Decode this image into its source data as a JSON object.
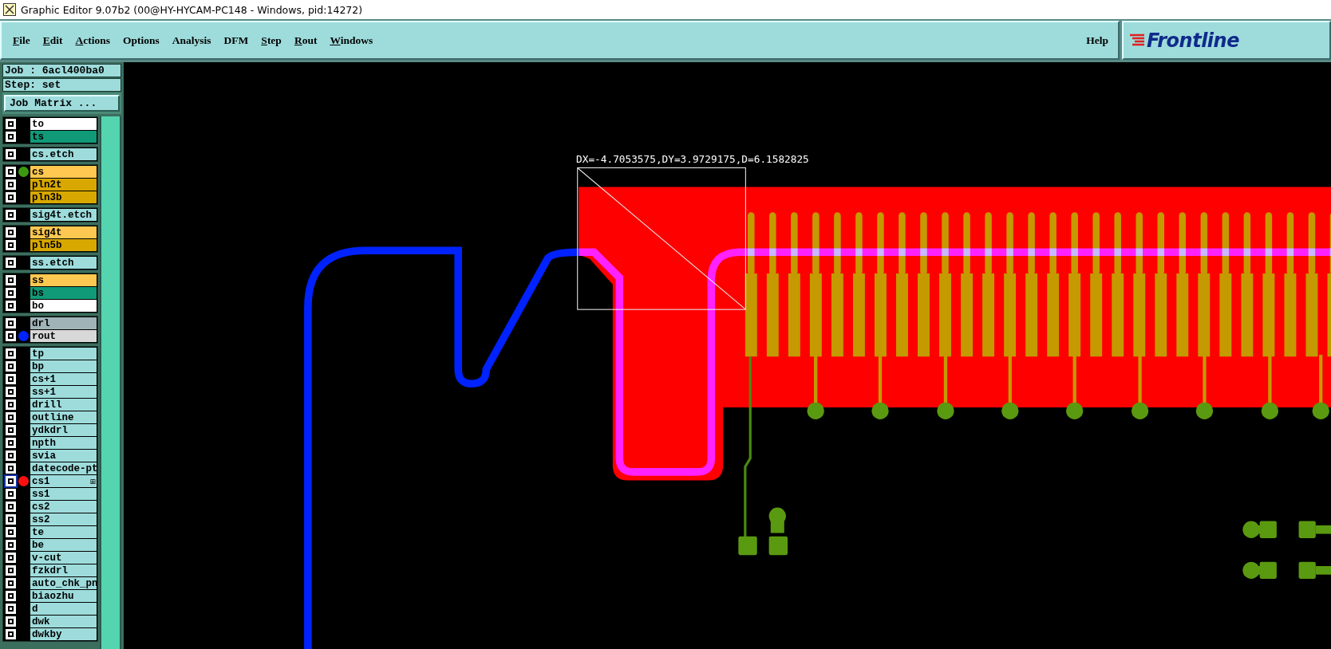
{
  "window": {
    "title": "Graphic Editor 9.07b2 (00@HY-HYCAM-PC148 - Windows, pid:14272)"
  },
  "menu": [
    {
      "label": "File",
      "mnemonic": true
    },
    {
      "label": "Edit",
      "mnemonic": true
    },
    {
      "label": "Actions",
      "mnemonic": true
    },
    {
      "label": "Options",
      "mnemonic": false
    },
    {
      "label": "Analysis",
      "mnemonic": false
    },
    {
      "label": "DFM",
      "mnemonic": false
    },
    {
      "label": "Step",
      "mnemonic": true
    },
    {
      "label": "Rout",
      "mnemonic": true
    },
    {
      "label": "Windows",
      "mnemonic": true
    }
  ],
  "help": {
    "label": "Help"
  },
  "logo": {
    "text": "Frontline"
  },
  "job": {
    "job": "Job : 6acl400ba0",
    "step": "Step: set",
    "matrix_button": "Job Matrix ..."
  },
  "layer_groups": [
    {
      "layers": [
        {
          "name": "to",
          "color": "#ffffff",
          "selected": false
        },
        {
          "name": "ts",
          "color": "#109a78",
          "selected": false
        }
      ]
    },
    {
      "layers": [
        {
          "name": "cs.etch",
          "color": "#9edcdc",
          "selected": false
        }
      ]
    },
    {
      "layers": [
        {
          "name": "cs",
          "color": "#ffc850",
          "selected": false,
          "dot": {
            "color": "#3c9a10"
          }
        },
        {
          "name": "pln2t",
          "color": "#d8a800",
          "selected": false
        },
        {
          "name": "pln3b",
          "color": "#d8a800",
          "selected": false
        }
      ]
    },
    {
      "layers": [
        {
          "name": "sig4t.etch",
          "color": "#9edcdc",
          "selected": false
        }
      ]
    },
    {
      "layers": [
        {
          "name": "sig4t",
          "color": "#ffc850",
          "selected": false
        },
        {
          "name": "pln5b",
          "color": "#d8a800",
          "selected": false
        }
      ]
    },
    {
      "layers": [
        {
          "name": "ss.etch",
          "color": "#9edcdc",
          "selected": false
        }
      ]
    },
    {
      "layers": [
        {
          "name": "ss",
          "color": "#ffc850",
          "selected": false
        },
        {
          "name": "bs",
          "color": "#109a78",
          "selected": false
        },
        {
          "name": "bo",
          "color": "#ffffff",
          "selected": false
        }
      ]
    },
    {
      "layers": [
        {
          "name": "drl",
          "color": "#a0b4b8",
          "selected": false
        },
        {
          "name": "rout",
          "color": "#d8d8d8",
          "selected": false,
          "dot": {
            "color": "#0022ff"
          }
        }
      ]
    },
    {
      "layers": [
        {
          "name": "tp",
          "color": "#9edcdc",
          "selected": false
        },
        {
          "name": "bp",
          "color": "#9edcdc",
          "selected": false
        },
        {
          "name": "cs+1",
          "color": "#9edcdc",
          "selected": false
        },
        {
          "name": "ss+1",
          "color": "#9edcdc",
          "selected": false
        },
        {
          "name": "drill",
          "color": "#9edcdc",
          "selected": false
        },
        {
          "name": "outline",
          "color": "#9edcdc",
          "selected": false
        },
        {
          "name": "ydkdrl",
          "color": "#9edcdc",
          "selected": false
        },
        {
          "name": "npth",
          "color": "#9edcdc",
          "selected": false
        },
        {
          "name": "svia",
          "color": "#9edcdc",
          "selected": false
        },
        {
          "name": "datecode-pt",
          "color": "#9edcdc",
          "selected": false
        },
        {
          "name": "cs1",
          "color": "#9edcdc",
          "selected": true,
          "dot": {
            "color": "#ff1010"
          },
          "marker": "⊞"
        },
        {
          "name": "ss1",
          "color": "#9edcdc",
          "selected": false
        },
        {
          "name": "cs2",
          "color": "#9edcdc",
          "selected": false
        },
        {
          "name": "ss2",
          "color": "#9edcdc",
          "selected": false
        },
        {
          "name": "te",
          "color": "#9edcdc",
          "selected": false
        },
        {
          "name": "be",
          "color": "#9edcdc",
          "selected": false
        },
        {
          "name": "v-cut",
          "color": "#9edcdc",
          "selected": false
        },
        {
          "name": "fzkdrl",
          "color": "#9edcdc",
          "selected": false
        },
        {
          "name": "auto_chk_pn",
          "color": "#9edcdc",
          "selected": false
        },
        {
          "name": "biaozhu",
          "color": "#9edcdc",
          "selected": false
        },
        {
          "name": "d",
          "color": "#9edcdc",
          "selected": false
        },
        {
          "name": "dwk",
          "color": "#9edcdc",
          "selected": false
        },
        {
          "name": "dwkby",
          "color": "#9edcdc",
          "selected": false
        }
      ]
    }
  ],
  "canvas": {
    "measure_readout": "DX=-4.7053575,DY=3.9729175,D=6.1582825"
  }
}
